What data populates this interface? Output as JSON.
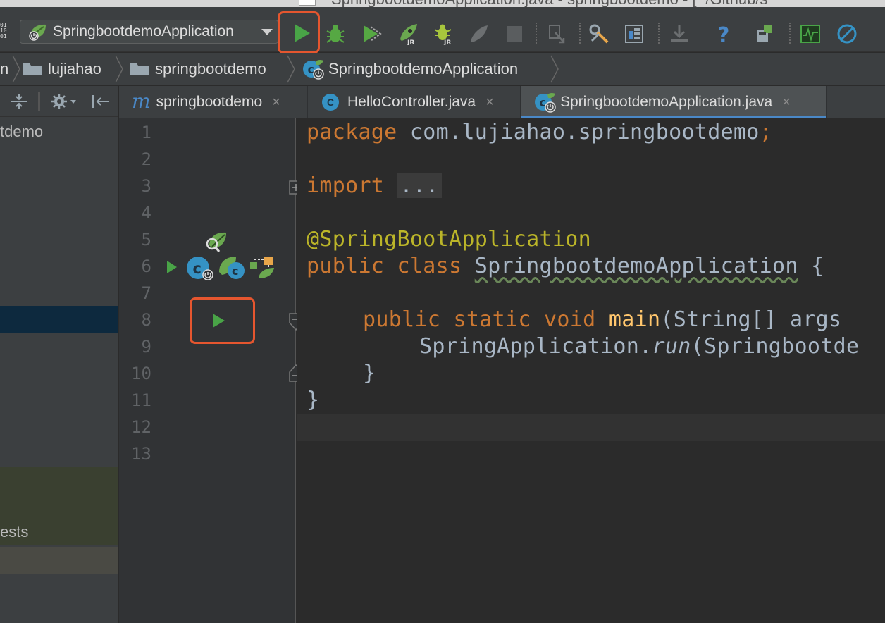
{
  "window": {
    "title": "SpringbootdemoApplication.java - springbootdemo - [~/Github/s"
  },
  "toolbar": {
    "binary_glyph": "01\n10\n01",
    "run_config_label": "SpringbootdemoApplication",
    "icons": [
      "run-icon",
      "debug-icon",
      "coverage-icon",
      "jrebel-run-icon",
      "jrebel-debug-icon",
      "profile-icon",
      "stop-icon",
      "sync-icon",
      "settings-icon",
      "project-structure-icon",
      "download-icon",
      "help-icon",
      "sdk-icon",
      "activity-monitor-icon",
      "power-save-icon"
    ]
  },
  "breadcrumb": {
    "items": [
      {
        "label": "n"
      },
      {
        "label": "lujiahao"
      },
      {
        "label": "springbootdemo"
      },
      {
        "label": "SpringbootdemoApplication"
      }
    ]
  },
  "left_panel": {
    "project_label": "tdemo",
    "tests_label": "ests"
  },
  "tabs": [
    {
      "label": "springbootdemo",
      "close": "×",
      "icon": "maven-module-icon",
      "active": false
    },
    {
      "label": "HelloController.java",
      "close": "×",
      "icon": "class-icon",
      "active": false
    },
    {
      "label": "SpringbootdemoApplication.java",
      "close": "×",
      "icon": "spring-boot-class-icon",
      "active": true
    }
  ],
  "gutter": {
    "line_numbers": [
      "1",
      "2",
      "3",
      "4",
      "5",
      "6",
      "7",
      "8",
      "9",
      "10",
      "11",
      "12",
      "13"
    ],
    "class_icon_letter": "c"
  },
  "code": {
    "l1_kw": "package",
    "l1_rest": " com.lujiahao.springbootdemo",
    "l1_semi": ";",
    "l3_kw": "import",
    "l3_fold": "...",
    "l6_ann": "@SpringBootApplication",
    "l7_kw": "public class",
    "l7_name": "SpringbootdemoApplication",
    "l7_brace": " {",
    "l9_kw": "public static void",
    "l9_fn": "main",
    "l9_rest": "(String[] args",
    "l10_a": "SpringApplication.",
    "l10_it": "run",
    "l10_b": "(Springbootde",
    "l11": "}",
    "l12": "}"
  },
  "colors": {
    "accent_highlight": "#e5562f",
    "run_green": "#49a447",
    "keyword": "#cc7832",
    "annotation": "#bbb529",
    "function": "#ffc66d"
  }
}
